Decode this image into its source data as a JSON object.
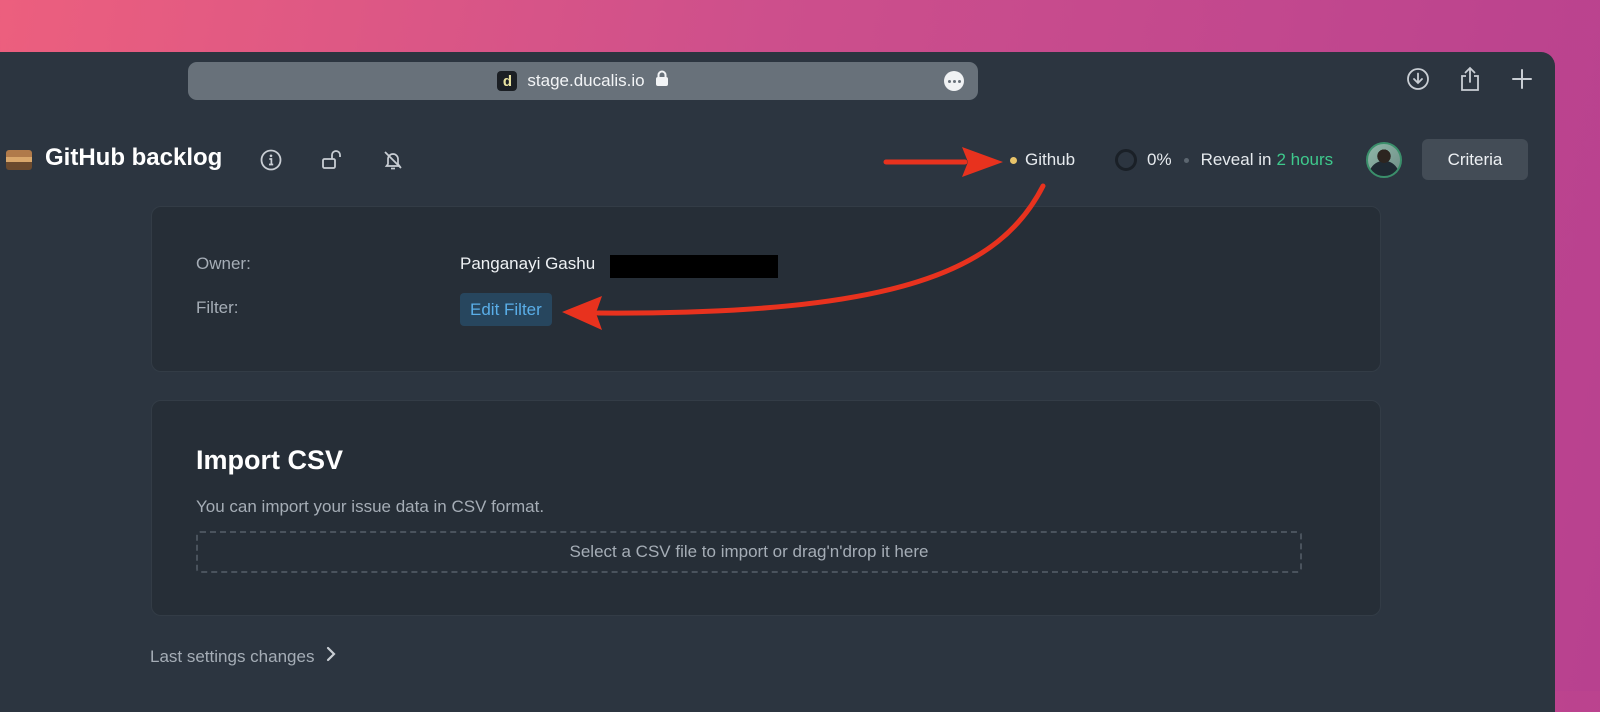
{
  "browser": {
    "url": "stage.ducalis.io",
    "favicon_letter": "d",
    "icons": [
      "lock-icon",
      "more-icon",
      "download-icon",
      "share-icon",
      "new-tab-icon"
    ]
  },
  "header": {
    "title": "GitHub backlog",
    "integration": "Github",
    "progress": "0%",
    "reveal_label": "Reveal in",
    "reveal_time": "2 hours",
    "criteria_label": "Criteria",
    "icons": [
      "info-icon",
      "unlock-icon",
      "notifications-off-icon"
    ]
  },
  "info_card": {
    "owner_label": "Owner:",
    "owner_value": "Panganayi Gashu",
    "filter_label": "Filter:",
    "edit_filter_label": "Edit Filter"
  },
  "import_card": {
    "title": "Import CSV",
    "description": "You can import your issue data in CSV format.",
    "dropzone_text": "Select a CSV file to import or drag'n'drop it here"
  },
  "footer": {
    "last_settings_label": "Last settings changes"
  },
  "colors": {
    "accent_green": "#3ec98c",
    "link_blue": "#5aaee8",
    "annotation_red": "#e8321e",
    "status_yellow": "#e9c46a"
  }
}
